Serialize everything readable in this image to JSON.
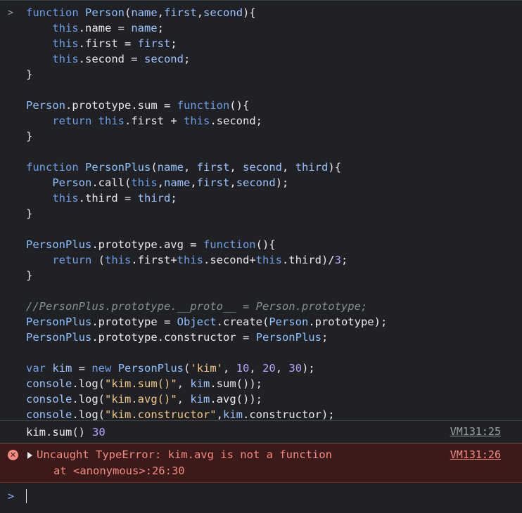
{
  "colors": {
    "background": "#202124",
    "error_background": "#3d1a1a",
    "error_text": "#f28b82",
    "link": "#9aa0a6",
    "number": "#b9a5ff"
  },
  "prompt_symbol": ">",
  "code_lines": [
    [
      [
        "k",
        "function"
      ],
      [
        "t",
        " "
      ],
      [
        "c",
        "Person"
      ],
      [
        "t",
        "("
      ],
      [
        "i",
        "name"
      ],
      [
        "t",
        ","
      ],
      [
        "i",
        "first"
      ],
      [
        "t",
        ","
      ],
      [
        "i",
        "second"
      ],
      [
        "t",
        "){"
      ]
    ],
    [
      [
        "t",
        "    "
      ],
      [
        "k",
        "this"
      ],
      [
        "t",
        ".name = "
      ],
      [
        "i",
        "name"
      ],
      [
        "t",
        ";"
      ]
    ],
    [
      [
        "t",
        "    "
      ],
      [
        "k",
        "this"
      ],
      [
        "t",
        ".first = "
      ],
      [
        "i",
        "first"
      ],
      [
        "t",
        ";"
      ]
    ],
    [
      [
        "t",
        "    "
      ],
      [
        "k",
        "this"
      ],
      [
        "t",
        ".second = "
      ],
      [
        "i",
        "second"
      ],
      [
        "t",
        ";"
      ]
    ],
    [
      [
        "t",
        "}"
      ]
    ],
    [
      [
        "t",
        ""
      ]
    ],
    [
      [
        "c",
        "Person"
      ],
      [
        "t",
        ".prototype.sum = "
      ],
      [
        "k",
        "function"
      ],
      [
        "t",
        "(){"
      ]
    ],
    [
      [
        "t",
        "    "
      ],
      [
        "k",
        "return"
      ],
      [
        "t",
        " "
      ],
      [
        "k",
        "this"
      ],
      [
        "t",
        ".first + "
      ],
      [
        "k",
        "this"
      ],
      [
        "t",
        ".second;"
      ]
    ],
    [
      [
        "t",
        "}"
      ]
    ],
    [
      [
        "t",
        ""
      ]
    ],
    [
      [
        "k",
        "function"
      ],
      [
        "t",
        " "
      ],
      [
        "c",
        "PersonPlus"
      ],
      [
        "t",
        "("
      ],
      [
        "i",
        "name"
      ],
      [
        "t",
        ", "
      ],
      [
        "i",
        "first"
      ],
      [
        "t",
        ", "
      ],
      [
        "i",
        "second"
      ],
      [
        "t",
        ", "
      ],
      [
        "i",
        "third"
      ],
      [
        "t",
        "){"
      ]
    ],
    [
      [
        "t",
        "    "
      ],
      [
        "c",
        "Person"
      ],
      [
        "t",
        ".call("
      ],
      [
        "k",
        "this"
      ],
      [
        "t",
        ","
      ],
      [
        "i",
        "name"
      ],
      [
        "t",
        ","
      ],
      [
        "i",
        "first"
      ],
      [
        "t",
        ","
      ],
      [
        "i",
        "second"
      ],
      [
        "t",
        ");"
      ]
    ],
    [
      [
        "t",
        "    "
      ],
      [
        "k",
        "this"
      ],
      [
        "t",
        ".third = "
      ],
      [
        "i",
        "third"
      ],
      [
        "t",
        ";"
      ]
    ],
    [
      [
        "t",
        "}"
      ]
    ],
    [
      [
        "t",
        ""
      ]
    ],
    [
      [
        "c",
        "PersonPlus"
      ],
      [
        "t",
        ".prototype.avg = "
      ],
      [
        "k",
        "function"
      ],
      [
        "t",
        "(){"
      ]
    ],
    [
      [
        "t",
        "    "
      ],
      [
        "k",
        "return"
      ],
      [
        "t",
        " ("
      ],
      [
        "k",
        "this"
      ],
      [
        "t",
        ".first+"
      ],
      [
        "k",
        "this"
      ],
      [
        "t",
        ".second+"
      ],
      [
        "k",
        "this"
      ],
      [
        "t",
        ".third)/"
      ],
      [
        "n",
        "3"
      ],
      [
        "t",
        ";"
      ]
    ],
    [
      [
        "t",
        "}"
      ]
    ],
    [
      [
        "t",
        ""
      ]
    ],
    [
      [
        "m",
        "//PersonPlus.prototype.__proto__ = Person.prototype;"
      ]
    ],
    [
      [
        "c",
        "PersonPlus"
      ],
      [
        "t",
        ".prototype = "
      ],
      [
        "c",
        "Object"
      ],
      [
        "t",
        ".create("
      ],
      [
        "c",
        "Person"
      ],
      [
        "t",
        ".prototype);"
      ]
    ],
    [
      [
        "c",
        "PersonPlus"
      ],
      [
        "t",
        ".prototype.constructor = "
      ],
      [
        "c",
        "PersonPlus"
      ],
      [
        "t",
        ";"
      ]
    ],
    [
      [
        "t",
        ""
      ]
    ],
    [
      [
        "k",
        "var"
      ],
      [
        "t",
        " "
      ],
      [
        "i",
        "kim"
      ],
      [
        "t",
        " = "
      ],
      [
        "k",
        "new"
      ],
      [
        "t",
        " "
      ],
      [
        "c",
        "PersonPlus"
      ],
      [
        "t",
        "("
      ],
      [
        "s",
        "'kim'"
      ],
      [
        "t",
        ", "
      ],
      [
        "n",
        "10"
      ],
      [
        "t",
        ", "
      ],
      [
        "n",
        "20"
      ],
      [
        "t",
        ", "
      ],
      [
        "n",
        "30"
      ],
      [
        "t",
        ");"
      ]
    ],
    [
      [
        "i",
        "console"
      ],
      [
        "t",
        ".log("
      ],
      [
        "s",
        "\"kim.sum()\""
      ],
      [
        "t",
        ", "
      ],
      [
        "i",
        "kim"
      ],
      [
        "t",
        ".sum());"
      ]
    ],
    [
      [
        "i",
        "console"
      ],
      [
        "t",
        ".log("
      ],
      [
        "s",
        "\"kim.avg()\""
      ],
      [
        "t",
        ", "
      ],
      [
        "i",
        "kim"
      ],
      [
        "t",
        ".avg());"
      ]
    ],
    [
      [
        "i",
        "console"
      ],
      [
        "t",
        ".log("
      ],
      [
        "s",
        "\"kim.constructor\""
      ],
      [
        "t",
        ","
      ],
      [
        "i",
        "kim"
      ],
      [
        "t",
        ".constructor);"
      ]
    ]
  ],
  "output": {
    "label": "kim.sum()",
    "value": "30",
    "source": "VM131:25"
  },
  "error": {
    "message": "Uncaught TypeError: kim.avg is not a function",
    "stack": "at <anonymous>:26:30",
    "source": "VM131:26",
    "icon": "error-icon"
  },
  "input_prompt": ">"
}
